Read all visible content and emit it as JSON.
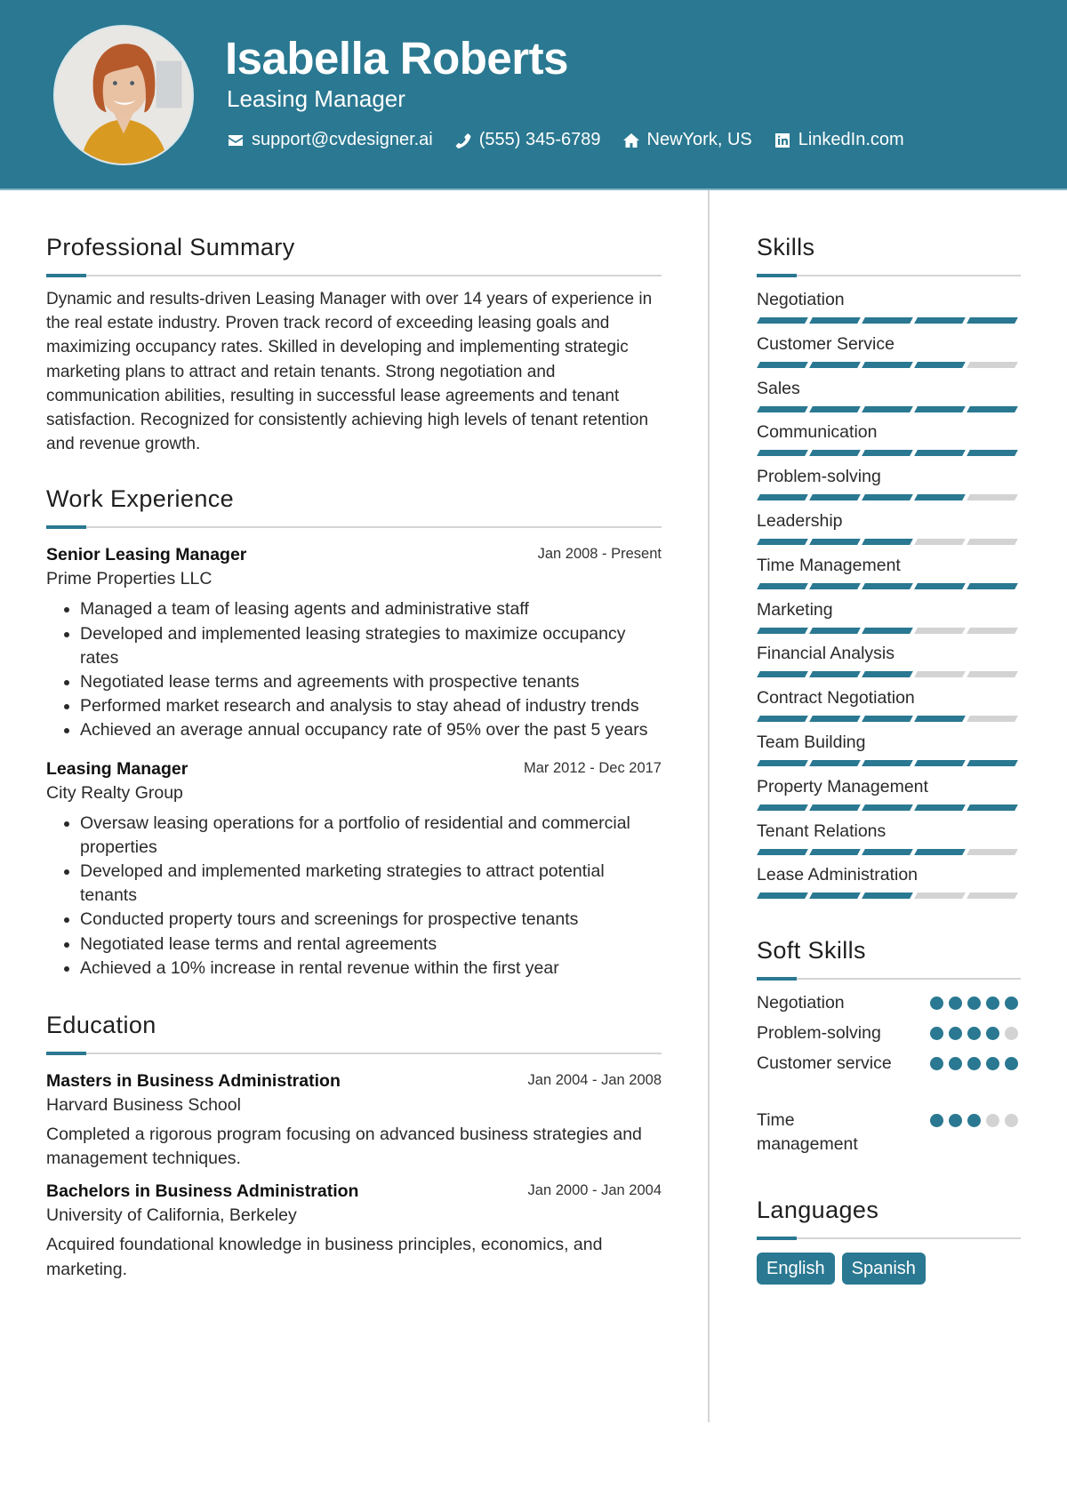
{
  "header": {
    "name": "Isabella Roberts",
    "title": "Leasing Manager",
    "photo_alt": "Profile photo of Isabella Roberts",
    "contacts": [
      {
        "icon": "envelope-icon",
        "text": "support@cvdesigner.ai"
      },
      {
        "icon": "phone-icon",
        "text": "(555) 345-6789"
      },
      {
        "icon": "home-icon",
        "text": "NewYork, US"
      },
      {
        "icon": "linkedin-icon",
        "text": "LinkedIn.com"
      }
    ]
  },
  "colors": {
    "accent": "#2a7891",
    "bar_empty": "#d3d3d3",
    "rule": "#d4d4d4"
  },
  "summary": {
    "heading": "Professional Summary",
    "text": "Dynamic and results-driven Leasing Manager with over 14 years of experience in the real estate industry. Proven track record of exceeding leasing goals and maximizing occupancy rates. Skilled in developing and implementing strategic marketing plans to attract and retain tenants. Strong negotiation and communication abilities, resulting in successful lease agreements and tenant satisfaction. Recognized for consistently achieving high levels of tenant retention and revenue growth."
  },
  "work": {
    "heading": "Work Experience",
    "jobs": [
      {
        "title": "Senior Leasing Manager",
        "company": "Prime Properties LLC",
        "dates": "Jan 2008 - Present",
        "bullets": [
          "Managed a team of leasing agents and administrative staff",
          "Developed and implemented leasing strategies to maximize occupancy rates",
          "Negotiated lease terms and agreements with prospective tenants",
          "Performed market research and analysis to stay ahead of industry trends",
          "Achieved an average annual occupancy rate of 95% over the past 5 years"
        ]
      },
      {
        "title": "Leasing Manager",
        "company": "City Realty Group",
        "dates": "Mar 2012 - Dec 2017",
        "bullets": [
          "Oversaw leasing operations for a portfolio of residential and commercial properties",
          "Developed and implemented marketing strategies to attract potential tenants",
          "Conducted property tours and screenings for prospective tenants",
          "Negotiated lease terms and rental agreements",
          "Achieved a 10% increase in rental revenue within the first year"
        ]
      }
    ]
  },
  "education": {
    "heading": "Education",
    "items": [
      {
        "degree": "Masters in Business Administration",
        "school": "Harvard Business School",
        "dates": "Jan 2004 - Jan 2008",
        "description": "Completed a rigorous program focusing on advanced business strategies and management techniques."
      },
      {
        "degree": "Bachelors in Business Administration",
        "school": "University of California, Berkeley",
        "dates": "Jan 2000 - Jan 2004",
        "description": "Acquired foundational knowledge in business principles, economics, and marketing."
      }
    ]
  },
  "skills": {
    "heading": "Skills",
    "max": 5,
    "items": [
      {
        "name": "Negotiation",
        "level": 5
      },
      {
        "name": "Customer Service",
        "level": 4
      },
      {
        "name": "Sales",
        "level": 5
      },
      {
        "name": "Communication",
        "level": 5
      },
      {
        "name": "Problem-solving",
        "level": 4
      },
      {
        "name": "Leadership",
        "level": 3
      },
      {
        "name": "Time Management",
        "level": 5
      },
      {
        "name": "Marketing",
        "level": 3
      },
      {
        "name": "Financial Analysis",
        "level": 3
      },
      {
        "name": "Contract Negotiation",
        "level": 4
      },
      {
        "name": "Team Building",
        "level": 5
      },
      {
        "name": "Property Management",
        "level": 5
      },
      {
        "name": "Tenant Relations",
        "level": 4
      },
      {
        "name": "Lease Administration",
        "level": 3
      }
    ]
  },
  "soft_skills": {
    "heading": "Soft Skills",
    "max": 5,
    "items": [
      {
        "name": "Negotiation",
        "level": 5
      },
      {
        "name": "Problem-solving",
        "level": 4
      },
      {
        "name": "Customer service",
        "level": 5
      },
      {
        "name": "Time management",
        "level": 3
      }
    ]
  },
  "languages": {
    "heading": "Languages",
    "items": [
      "English",
      "Spanish"
    ]
  }
}
